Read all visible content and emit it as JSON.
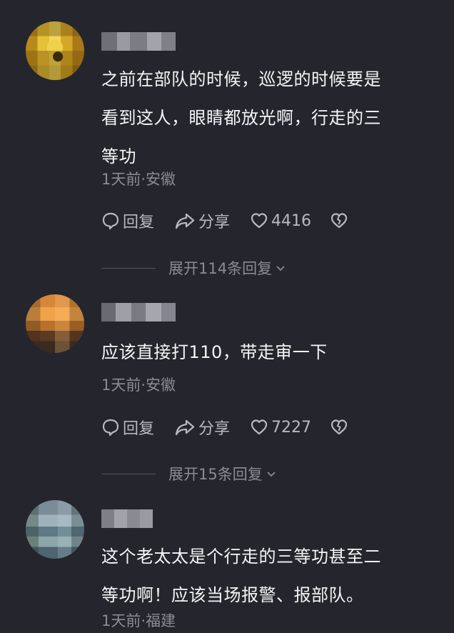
{
  "comments": [
    {
      "text": "之前在部队的时候，巡逻的时候要是\n看到这人，眼睛都放光啊，行走的三\n等功",
      "meta": "1天前·安徽",
      "reply_label": "回复",
      "share_label": "分享",
      "likes": "4416",
      "expand_label": "展开114条回复"
    },
    {
      "text": "应该直接打110，带走审一下",
      "meta": "1天前·安徽",
      "reply_label": "回复",
      "share_label": "分享",
      "likes": "7227",
      "expand_label": "展开15条回复"
    },
    {
      "text": "这个老太太是个行走的三等功甚至二\n等功啊！应该当场报警、报部队。",
      "meta": "1天前·福建"
    }
  ],
  "icons": {
    "reply": "comment-bubble-icon",
    "share": "share-arrow-icon",
    "like": "heart-icon",
    "dislike": "broken-heart-icon",
    "expand": "chevron-down-icon"
  },
  "colors": {
    "background": "#25252d",
    "text": "#f5f5f7",
    "meta": "#8b8b94",
    "actions": "#b8b8c0"
  }
}
